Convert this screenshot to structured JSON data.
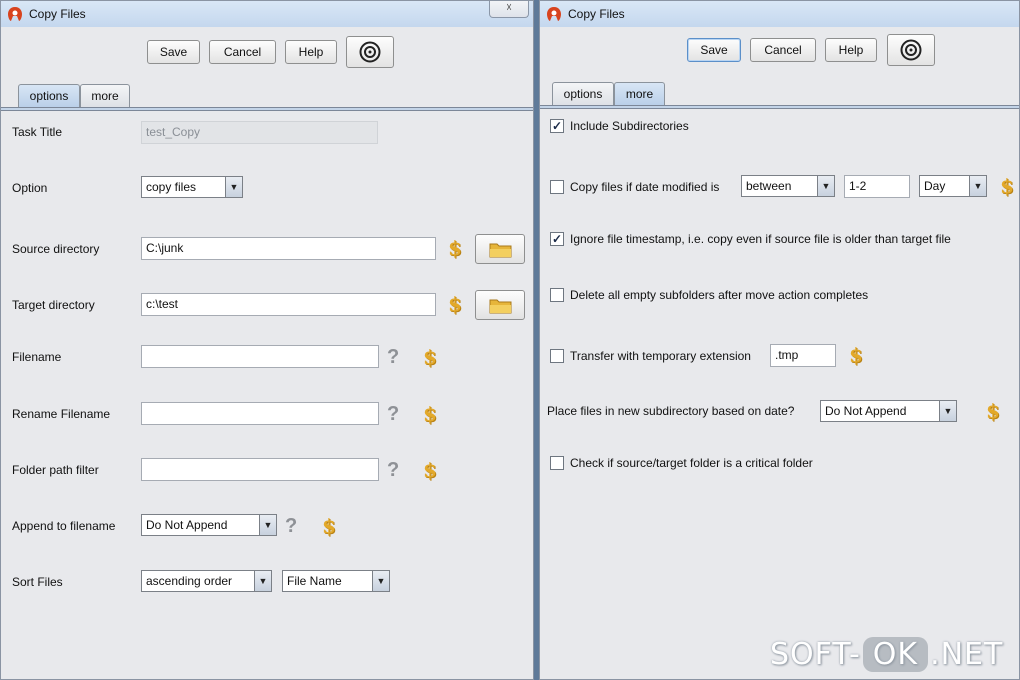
{
  "left_window": {
    "title": "Copy Files",
    "close_label": "☓",
    "toolbar": {
      "save": "Save",
      "cancel": "Cancel",
      "help": "Help"
    },
    "tabs": [
      "options",
      "more"
    ],
    "rows": {
      "task_title": {
        "label": "Task Title",
        "value": "test_Copy"
      },
      "option": {
        "label": "Option",
        "value": "copy files"
      },
      "source": {
        "label": "Source directory",
        "value": "C:\\junk"
      },
      "target": {
        "label": "Target directory",
        "value": "c:\\test"
      },
      "filename": {
        "label": "Filename",
        "value": ""
      },
      "rename": {
        "label": "Rename Filename",
        "value": ""
      },
      "folder_filter": {
        "label": "Folder path filter",
        "value": ""
      },
      "append": {
        "label": "Append to filename",
        "value": "Do Not Append"
      },
      "sort": {
        "label": "Sort Files",
        "order": "ascending order",
        "by": "File Name"
      }
    }
  },
  "right_window": {
    "title": "Copy Files",
    "toolbar": {
      "save": "Save",
      "cancel": "Cancel",
      "help": "Help"
    },
    "tabs": [
      "options",
      "more"
    ],
    "include_subdirs": {
      "label": "Include Subdirectories",
      "checked": true
    },
    "date_modified": {
      "label": "Copy files if date modified is",
      "checked": false,
      "mode": "between",
      "range": "1-2",
      "unit": "Day"
    },
    "ignore_timestamp": {
      "label": "Ignore file timestamp, i.e. copy even if source file is older than target file",
      "checked": true
    },
    "delete_empty": {
      "label": "Delete all empty subfolders after move action completes",
      "checked": false
    },
    "temp_ext": {
      "label": "Transfer with temporary extension",
      "checked": false,
      "value": ".tmp"
    },
    "subdir_date": {
      "label": "Place files in new subdirectory based on date?",
      "value": "Do Not Append"
    },
    "critical": {
      "label": "Check if source/target folder is a critical folder",
      "checked": false
    }
  },
  "symbols": {
    "dollar": "$",
    "question": "?",
    "check": "✓",
    "dropdown": "▼"
  },
  "watermark": {
    "part1": "SOFT-",
    "part2": "OK",
    "part3": ".NET"
  }
}
